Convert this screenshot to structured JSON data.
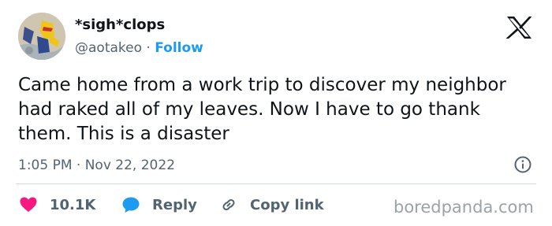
{
  "author": {
    "display_name": "*sigh*clops",
    "handle": "@aotakeo",
    "separator": "·",
    "follow_label": "Follow"
  },
  "tweet": {
    "text": "Came home from a work trip to discover my neighbor had raked all of my leaves. Now I have to go thank them. This is a disaster",
    "time": "1:05 PM",
    "date_separator": "·",
    "date": "Nov 22, 2022"
  },
  "actions": {
    "like_count": "10.1K",
    "reply_label": "Reply",
    "copy_link_label": "Copy link"
  },
  "watermark": "boredpanda.com",
  "icons": {
    "platform": "x-logo-icon",
    "info": "info-icon",
    "like": "heart-icon",
    "reply": "speech-bubble-icon",
    "copy_link": "link-icon"
  },
  "colors": {
    "like": "#f91880",
    "reply": "#1d9bf0",
    "follow": "#1d9bf0",
    "secondary_text": "#536471",
    "primary_text": "#0f1419",
    "divider": "#cfd9de"
  }
}
